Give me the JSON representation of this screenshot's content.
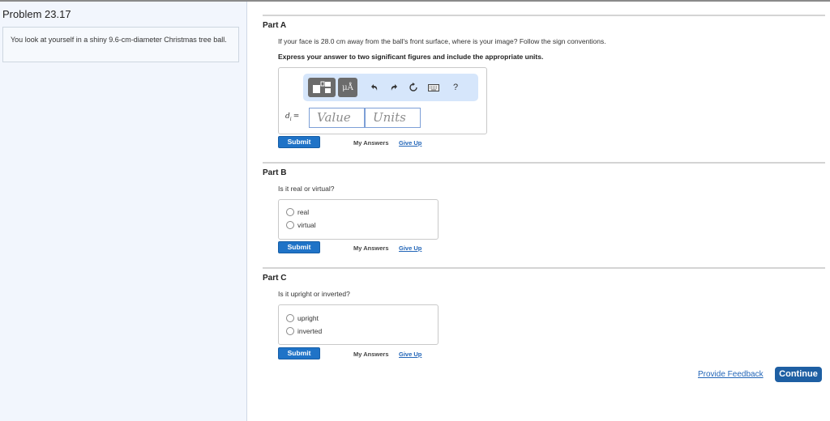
{
  "sidebar": {
    "title": "Problem 23.17",
    "prompt": "You look at yourself in a shiny 9.6-cm-diameter Christmas tree ball."
  },
  "partA": {
    "title": "Part A",
    "question": "If your face is 28.0  cm away from the ball's front surface, where is your image? Follow the sign conventions.",
    "instruction": "Express your answer to two significant figures and include the appropriate units.",
    "toolbar": {
      "templates_icon": "templates-icon",
      "units_label": "μÅ",
      "undo_icon": "undo-icon",
      "redo_icon": "redo-icon",
      "reset_icon": "reset-icon",
      "keyboard_icon": "keyboard-icon",
      "help_label": "?"
    },
    "variable": "d",
    "variable_sub": "i",
    "equals": "=",
    "value_placeholder": "Value",
    "units_placeholder": "Units",
    "submit_label": "Submit",
    "my_answers_label": "My Answers",
    "give_up_label": "Give Up"
  },
  "partB": {
    "title": "Part B",
    "question": "Is it real or virtual?",
    "options": [
      "real",
      "virtual"
    ],
    "submit_label": "Submit",
    "my_answers_label": "My Answers",
    "give_up_label": "Give Up"
  },
  "partC": {
    "title": "Part C",
    "question": "Is it upright or inverted?",
    "options": [
      "upright",
      "inverted"
    ],
    "submit_label": "Submit",
    "my_answers_label": "My Answers",
    "give_up_label": "Give Up"
  },
  "footer": {
    "feedback_label": "Provide Feedback",
    "continue_label": "Continue"
  },
  "colors": {
    "accent": "#1f73c7",
    "continue": "#1e5fa3",
    "link": "#2366b8",
    "toolbar_bg": "#d6e6fb",
    "sidebar_bg": "#f2f6fd"
  }
}
